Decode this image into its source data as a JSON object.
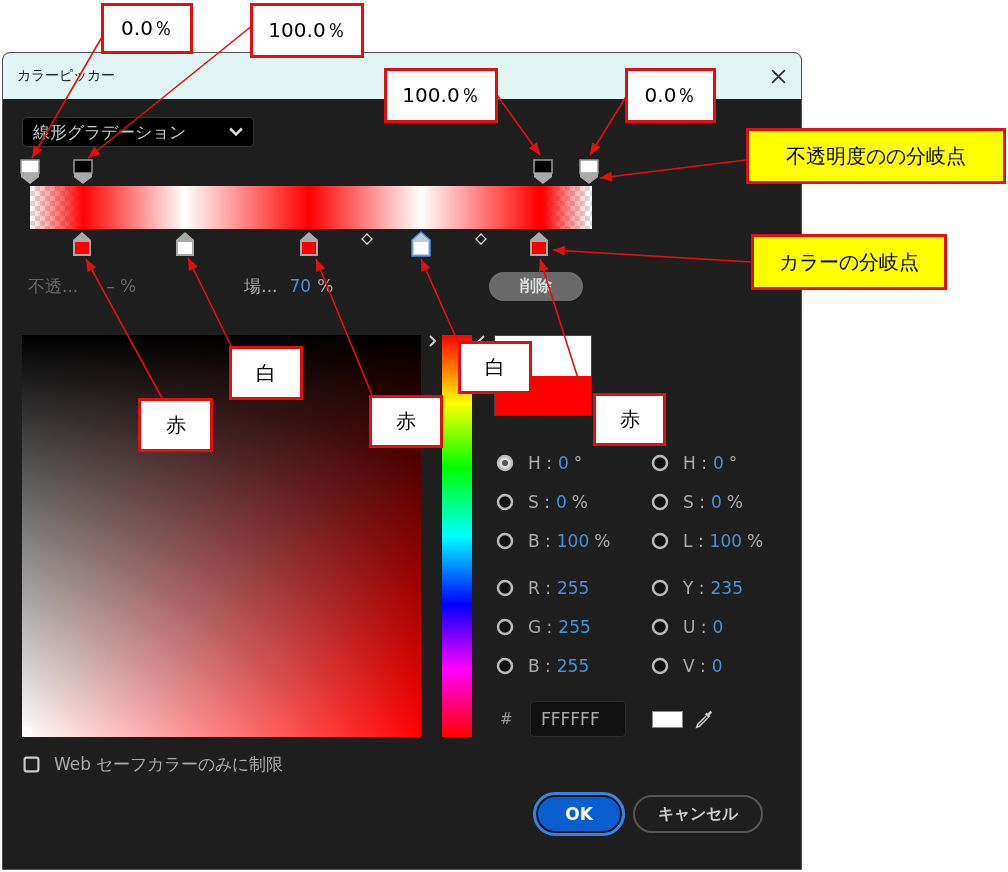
{
  "dialog": {
    "title": "カラーピッカー",
    "gradient_type": "線形グラデーション",
    "opacity_stops": [
      {
        "color": "#ffffff",
        "selected": false
      },
      {
        "color": "#000000",
        "selected": false
      },
      {
        "color": "#000000",
        "selected": false
      },
      {
        "color": "#ffffff",
        "selected": false
      }
    ],
    "color_stops": [
      {
        "color": "#ff0000",
        "selected": false
      },
      {
        "color": "#ffffff",
        "selected": false
      },
      {
        "color": "#ff0000",
        "selected": false
      },
      {
        "color": "#ffffff",
        "selected": true
      },
      {
        "color": "#ff0000",
        "selected": false
      }
    ],
    "opacity_label": "不透...",
    "opacity_value": "– %",
    "location_label": "場...",
    "location_value": "70",
    "location_unit": "%",
    "delete_button": "削除",
    "hue_slider": {
      "level": 0
    },
    "color_modes": [
      {
        "label": "H :",
        "value": "0",
        "unit": "°",
        "selected": true
      },
      {
        "label": "H :",
        "value": "0",
        "unit": "°",
        "selected": false
      },
      {
        "label": "S :",
        "value": "0",
        "unit": "%",
        "selected": false
      },
      {
        "label": "S :",
        "value": "0",
        "unit": "%",
        "selected": false
      },
      {
        "label": "B :",
        "value": "100",
        "unit": "%",
        "selected": false
      },
      {
        "label": "L :",
        "value": "100",
        "unit": "%",
        "selected": false
      },
      {
        "label": "R :",
        "value": "255",
        "selected": false
      },
      {
        "label": "Y :",
        "value": "235",
        "selected": false
      },
      {
        "label": "G :",
        "value": "255",
        "selected": false
      },
      {
        "label": "U :",
        "value": "0",
        "selected": false
      },
      {
        "label": "B :",
        "value": "255",
        "selected": false
      },
      {
        "label": "V :",
        "value": "0",
        "selected": false
      }
    ],
    "hex_label": "#",
    "hex_value": "FFFFFF",
    "web_safe": {
      "label": "Web セーフカラーのみに制限",
      "checked": false
    },
    "ok_button": "OK",
    "cancel_button": "キャンセル"
  },
  "annotations": [
    {
      "text": "0.0％",
      "kind": "box"
    },
    {
      "text": "100.0％",
      "kind": "box"
    },
    {
      "text": "100.0％",
      "kind": "box"
    },
    {
      "text": "0.0％",
      "kind": "box"
    },
    {
      "text": "不透明度のの分岐点",
      "kind": "highlight"
    },
    {
      "text": "カラーの分岐点",
      "kind": "highlight"
    },
    {
      "text": "白",
      "kind": "box"
    },
    {
      "text": "赤",
      "kind": "box"
    },
    {
      "text": "赤",
      "kind": "box"
    },
    {
      "text": "白",
      "kind": "box"
    },
    {
      "text": "赤",
      "kind": "box"
    }
  ]
}
